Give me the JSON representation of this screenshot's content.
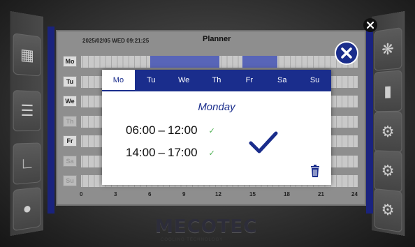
{
  "planner": {
    "datetime": "2025/02/05 WED 09:21:25",
    "title": "Planner",
    "days": [
      "Mo",
      "Tu",
      "We",
      "Th",
      "Fr",
      "Sa",
      "Su"
    ],
    "axis": [
      "0",
      "3",
      "6",
      "9",
      "12",
      "15",
      "18",
      "21",
      "24"
    ]
  },
  "dialog": {
    "tabs": [
      "Mo",
      "Tu",
      "We",
      "Th",
      "Fr",
      "Sa",
      "Su"
    ],
    "active_tab": "Mo",
    "day_heading": "Monday",
    "slots": [
      {
        "start": "06:00",
        "end": "12:00"
      },
      {
        "start": "14:00",
        "end": "17:00"
      }
    ],
    "slot_separator": "–"
  },
  "logo": {
    "text": "MECOTEC",
    "subtitle": "COOLING TECHNOLOGY"
  },
  "colors": {
    "accent": "#1a2d8c",
    "check": "#4caf50",
    "schedule_fill": "#5865b8"
  }
}
